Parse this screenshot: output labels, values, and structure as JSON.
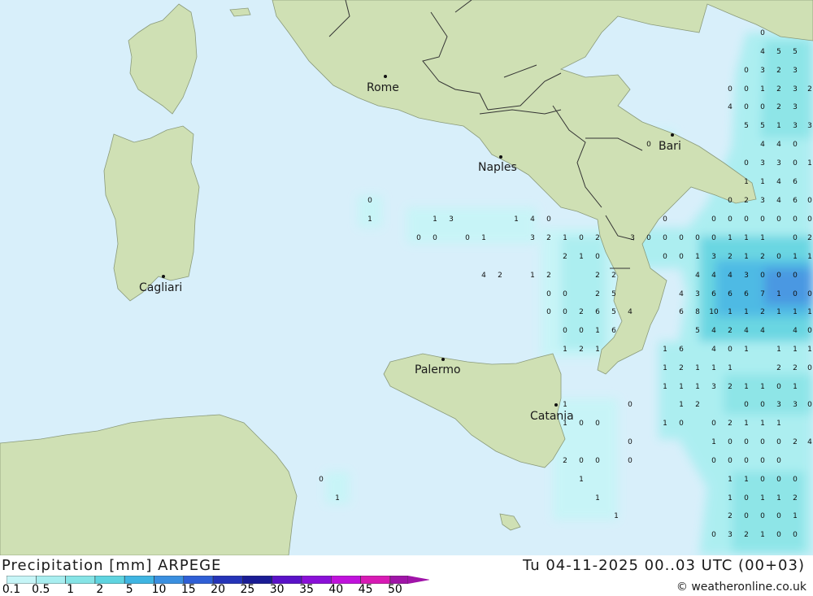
{
  "title": "Precipitation [mm] ARPEGE",
  "timestamp": "Tu 04-11-2025 00..03 UTC (00+03)",
  "credit": "© weatheronline.co.uk",
  "colors": {
    "sea": "#d8effa",
    "land": "#cfe0b4",
    "border": "#333333"
  },
  "legend": {
    "labels": [
      "0.1",
      "0.5",
      "1",
      "2",
      "5",
      "10",
      "15",
      "20",
      "25",
      "30",
      "35",
      "40",
      "45",
      "50"
    ],
    "colors": [
      "#c6f5f7",
      "#a8eef0",
      "#86e4e6",
      "#5fd4e0",
      "#3fb5e2",
      "#3a8fe0",
      "#2f5fd6",
      "#2534b8",
      "#1a1c95",
      "#5a12c8",
      "#8a10d8",
      "#c012dc",
      "#d81ab4",
      "#a014a8"
    ]
  },
  "cities": [
    {
      "name": "Rome"
    },
    {
      "name": "Naples"
    },
    {
      "name": "Bari"
    },
    {
      "name": "Cagliari"
    },
    {
      "name": "Palermo"
    },
    {
      "name": "Catania"
    }
  ],
  "grid_values": [
    "0",
    "4",
    "5",
    "5",
    "0",
    "3",
    "2",
    "3",
    "0",
    "0",
    "1",
    "2",
    "3",
    "2",
    "4",
    "0",
    "0",
    "2",
    "3",
    "5",
    "5",
    "1",
    "3",
    "3",
    "4",
    "4",
    "0",
    "0",
    "3",
    "3",
    "0",
    "1",
    "1",
    "1",
    "4",
    "6",
    "0",
    "2",
    "3",
    "4",
    "6",
    "0",
    "0",
    "1",
    "1",
    "3",
    "1",
    "4",
    "0",
    "0",
    "0",
    "0",
    "0",
    "0",
    "0",
    "0",
    "0",
    "0",
    "0",
    "0",
    "0",
    "1",
    "3",
    "2",
    "1",
    "0",
    "2",
    "3",
    "0",
    "0",
    "0",
    "0",
    "0",
    "1",
    "1",
    "1",
    "0",
    "2",
    "2",
    "1",
    "0",
    "0",
    "0",
    "1",
    "3",
    "2",
    "1",
    "2",
    "0",
    "1",
    "1",
    "4",
    "2",
    "1",
    "2",
    "2",
    "2",
    "4",
    "4",
    "4",
    "3",
    "0",
    "0",
    "0",
    "0",
    "0",
    "2",
    "5",
    "4",
    "3",
    "6",
    "6",
    "6",
    "7",
    "1",
    "0",
    "0",
    "0",
    "0",
    "2",
    "6",
    "5",
    "4",
    "6",
    "8",
    "10",
    "1",
    "1",
    "2",
    "1",
    "1",
    "1",
    "0",
    "0",
    "1",
    "6",
    "5",
    "4",
    "2",
    "4",
    "4",
    "4",
    "0",
    "1",
    "2",
    "1",
    "1",
    "6",
    "4",
    "0",
    "1",
    "1",
    "1",
    "1",
    "1",
    "2",
    "1",
    "1",
    "1",
    "2",
    "2",
    "0",
    "1",
    "1",
    "1",
    "3",
    "2",
    "1",
    "1",
    "0",
    "1",
    "1",
    "0",
    "1",
    "2",
    "0",
    "0",
    "3",
    "3",
    "0",
    "1",
    "0",
    "0",
    "1",
    "0",
    "0",
    "2",
    "1",
    "1",
    "1",
    "0",
    "1",
    "0",
    "0",
    "0",
    "0",
    "2",
    "4",
    "2",
    "0",
    "0",
    "0",
    "0",
    "0",
    "0",
    "0",
    "0",
    "0",
    "1",
    "1",
    "1",
    "0",
    "0",
    "0",
    "1",
    "1",
    "1",
    "0",
    "1",
    "1",
    "2",
    "1",
    "2",
    "0",
    "0",
    "0",
    "1",
    "0",
    "3",
    "2",
    "1",
    "0",
    "0",
    "1",
    "3",
    "3",
    "1",
    "0",
    "0",
    "1",
    "1",
    "2",
    "0"
  ]
}
